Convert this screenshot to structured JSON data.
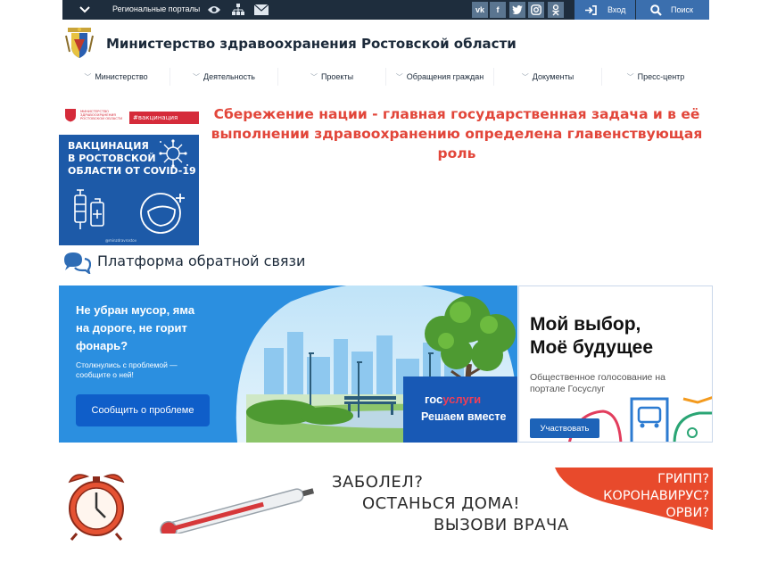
{
  "topbar": {
    "regional_portals": "Региональные порталы",
    "social": [
      "vk",
      "f",
      "t",
      "ig",
      "ok"
    ],
    "login": "Вход",
    "search": "Поиск"
  },
  "header": {
    "title": "Министерство здравоохранения Ростовской области"
  },
  "nav": {
    "items": [
      "Министерство",
      "Деятельность",
      "Проекты",
      "Обращения граждан",
      "Документы",
      "Пресс-центр"
    ]
  },
  "vaccine_banner": {
    "ministry_small": "МИНИСТЕРСТВО ЗДРАВООХРАНЕНИЯ РОСТОВСКОЙ ОБЛАСТИ",
    "hashtag": "#вакцинация",
    "line1": "ВАКЦИНАЦИЯ",
    "line2": "В РОСТОВСКОЙ",
    "line3": "ОБЛАСТИ ОТ COVID-19",
    "handle": "@minzdravrostov"
  },
  "headline": {
    "line1": "Сбережение нации - главная государственная задача и в её",
    "line2": "выполнении здравоохранению определена главенствующая роль"
  },
  "feedback": {
    "title": "Платформа обратной связи",
    "question_l1": "Не убран мусор, яма",
    "question_l2": "на дороге, не горит",
    "question_l3": "фонарь?",
    "sub_l1": "Столкнулись с проблемой —",
    "sub_l2": "сообщите о ней!",
    "button": "Сообщить о проблеме",
    "gos_a": "гос",
    "gos_b": "услуги",
    "gos_sub": "Решаем вместе"
  },
  "vote": {
    "title_l1": "Мой выбор,",
    "title_l2": "Моё будущее",
    "sub_l1": "Общественное голосование на",
    "sub_l2": "портале Госуслуг",
    "button": "Участвовать"
  },
  "flu_banner": {
    "line1": "ЗАБОЛЕЛ?",
    "line2": "ОСТАНЬСЯ ДОМА!",
    "line3": "ВЫЗОВИ ВРАЧА",
    "red_l1": "ГРИПП?",
    "red_l2": "КОРОНАВИРУС?",
    "red_l3": "ОРВИ?"
  },
  "colors": {
    "topbar": "#1e2d3d",
    "accent_blue": "#3b6fae",
    "headline_red": "#e2463a",
    "flu_red": "#e84a2c"
  }
}
